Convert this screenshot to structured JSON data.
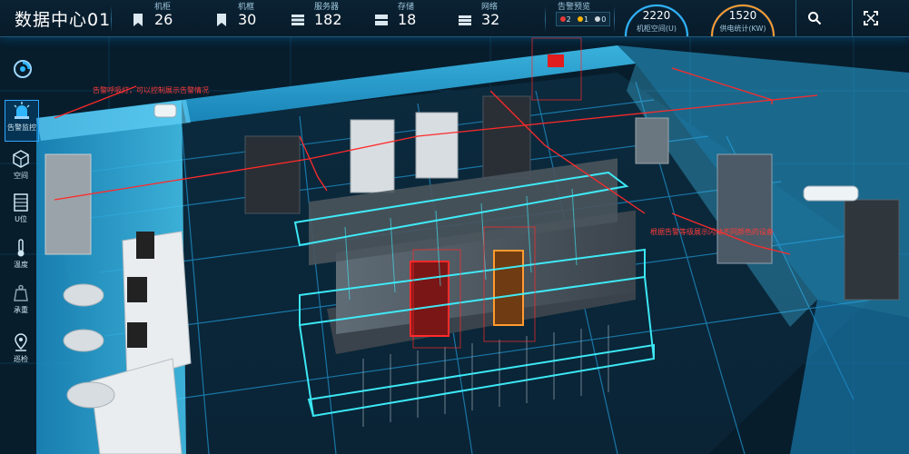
{
  "header": {
    "title": "数据中心01",
    "stats": [
      {
        "label": "机柜",
        "value": "26",
        "icon": "bookmark-icon"
      },
      {
        "label": "机框",
        "value": "30",
        "icon": "bookmark-icon"
      },
      {
        "label": "服务器",
        "value": "182",
        "icon": "server-icon"
      },
      {
        "label": "存储",
        "value": "18",
        "icon": "storage-icon"
      },
      {
        "label": "网络",
        "value": "32",
        "icon": "network-icon"
      }
    ],
    "alarm": {
      "label": "告警预览",
      "levels": [
        {
          "count": "2",
          "color": "#e53935"
        },
        {
          "count": "1",
          "color": "#ffb300"
        },
        {
          "count": "0",
          "color": "#cfd8dc"
        }
      ]
    },
    "gauges": [
      {
        "value": "2220",
        "label": "机柜空间(U)",
        "color": "#2fb6ff"
      },
      {
        "value": "1520",
        "label": "供电统计(KW)",
        "color": "#ff9b2f"
      }
    ],
    "tools": [
      {
        "name": "search-button",
        "icon": "search-icon"
      },
      {
        "name": "fullscreen-button",
        "icon": "expand-icon"
      }
    ]
  },
  "sidebar": {
    "logo_icon": "refresh-logo-icon",
    "items": [
      {
        "label": "告警监控",
        "icon": "alarm-light-icon",
        "active": true
      },
      {
        "label": "空间",
        "icon": "space-cube-icon"
      },
      {
        "label": "U位",
        "icon": "u-position-icon"
      },
      {
        "label": "温度",
        "icon": "thermometer-icon"
      },
      {
        "label": "承重",
        "icon": "weight-icon"
      },
      {
        "label": "巡检",
        "icon": "location-pin-icon"
      }
    ]
  },
  "annotations": {
    "alarm_light": "告警呼吸灯，可以控制展示告警情况",
    "device_flash": "根据告警等级展示闪动不同颜色的设备"
  }
}
